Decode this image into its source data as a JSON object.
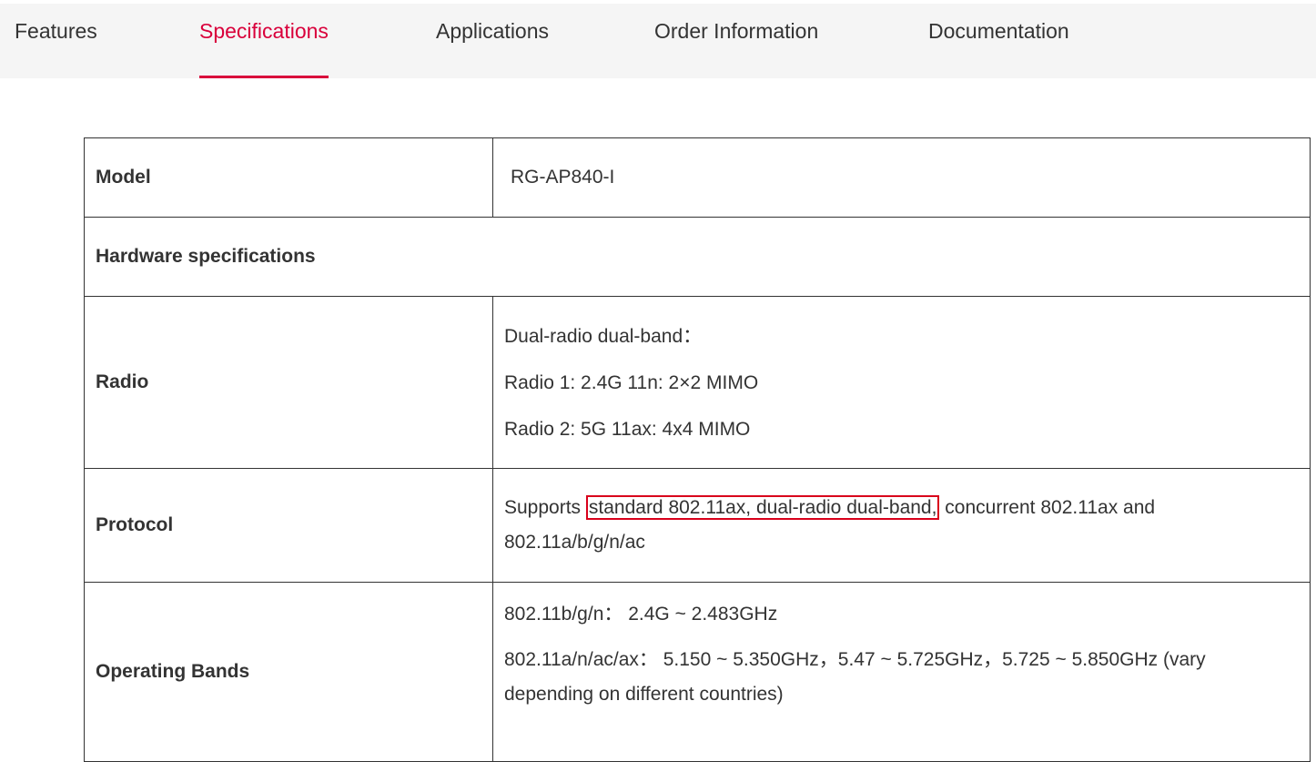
{
  "tabs": [
    {
      "label": "Features",
      "active": false
    },
    {
      "label": "Specifications",
      "active": true
    },
    {
      "label": "Applications",
      "active": false
    },
    {
      "label": "Order Information",
      "active": false
    },
    {
      "label": "Documentation",
      "active": false
    }
  ],
  "colors": {
    "accent": "#d9003b",
    "tabbar_bg": "#f5f5f5",
    "text": "#333333",
    "highlight_border": "#d9001b"
  },
  "table": {
    "model": {
      "label": "Model",
      "value": "RG-AP840-I"
    },
    "hardware_section": "Hardware specifications",
    "radio": {
      "label": "Radio",
      "lines": [
        "Dual-radio dual-band：",
        "Radio 1: 2.4G 11n: 2×2 MIMO",
        "Radio 2: 5G 11ax: 4x4 MIMO"
      ]
    },
    "protocol": {
      "label": "Protocol",
      "prefix": "Supports ",
      "highlighted": "standard 802.11ax, dual-radio dual-band,",
      "suffix": " concurrent 802.11ax and 802.11a/b/g/n/ac"
    },
    "bands": {
      "label": "Operating Bands",
      "lines": [
        "802.11b/g/n： 2.4G ~ 2.483GHz",
        "802.11a/n/ac/ax： 5.150 ~ 5.350GHz，5.47 ~ 5.725GHz，5.725 ~ 5.850GHz (vary depending on different countries)"
      ]
    }
  }
}
